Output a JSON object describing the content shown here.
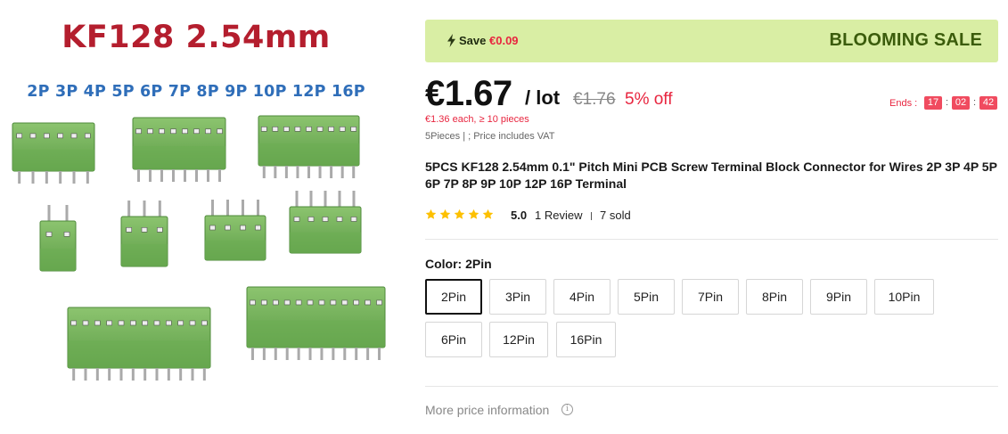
{
  "product_image": {
    "title": "KF128 2.54mm",
    "subtitle": "2P 3P 4P 5P 6P 7P 8P 9P 10P 12P 16P",
    "title_color": "#b41e2e",
    "subtitle_color": "#2f6eb9",
    "terminal_green": "#6cae53",
    "image_icon": "terminal-blocks-photo"
  },
  "sale_banner": {
    "icon": "bolt-icon",
    "save_label": "Save",
    "save_amount": "€0.09",
    "title": "BLOOMING SALE",
    "background": "#d9eea4",
    "title_color": "#3b5c0c"
  },
  "price": {
    "current": "€1.67",
    "unit": "/ lot",
    "original": "€1.76",
    "discount": "5% off",
    "bulk": "€1.36 each, ≥ 10 pieces",
    "vat_line": "5Pieces | ; Price includes VAT",
    "accent_color": "#e8253f"
  },
  "countdown": {
    "label": "Ends :",
    "hours": "17",
    "minutes": "02",
    "seconds": "42",
    "separator": ":"
  },
  "product_title": "5PCS KF128 2.54mm 0.1\" Pitch Mini PCB Screw Terminal Block Connector for Wires 2P 3P 4P 5P 6P 7P 8P 9P 10P 12P 16P Terminal",
  "rating": {
    "value": "5.0",
    "stars": 5,
    "star_color": "#fdc000",
    "reviews": "1 Review",
    "sold": "7 sold"
  },
  "color_selector": {
    "label": "Color:",
    "selected": "2Pin",
    "options": [
      "2Pin",
      "3Pin",
      "4Pin",
      "5Pin",
      "7Pin",
      "8Pin",
      "9Pin",
      "10Pin",
      "6Pin",
      "12Pin",
      "16Pin"
    ]
  },
  "more_info": {
    "label": "More price information",
    "icon": "info-icon"
  }
}
